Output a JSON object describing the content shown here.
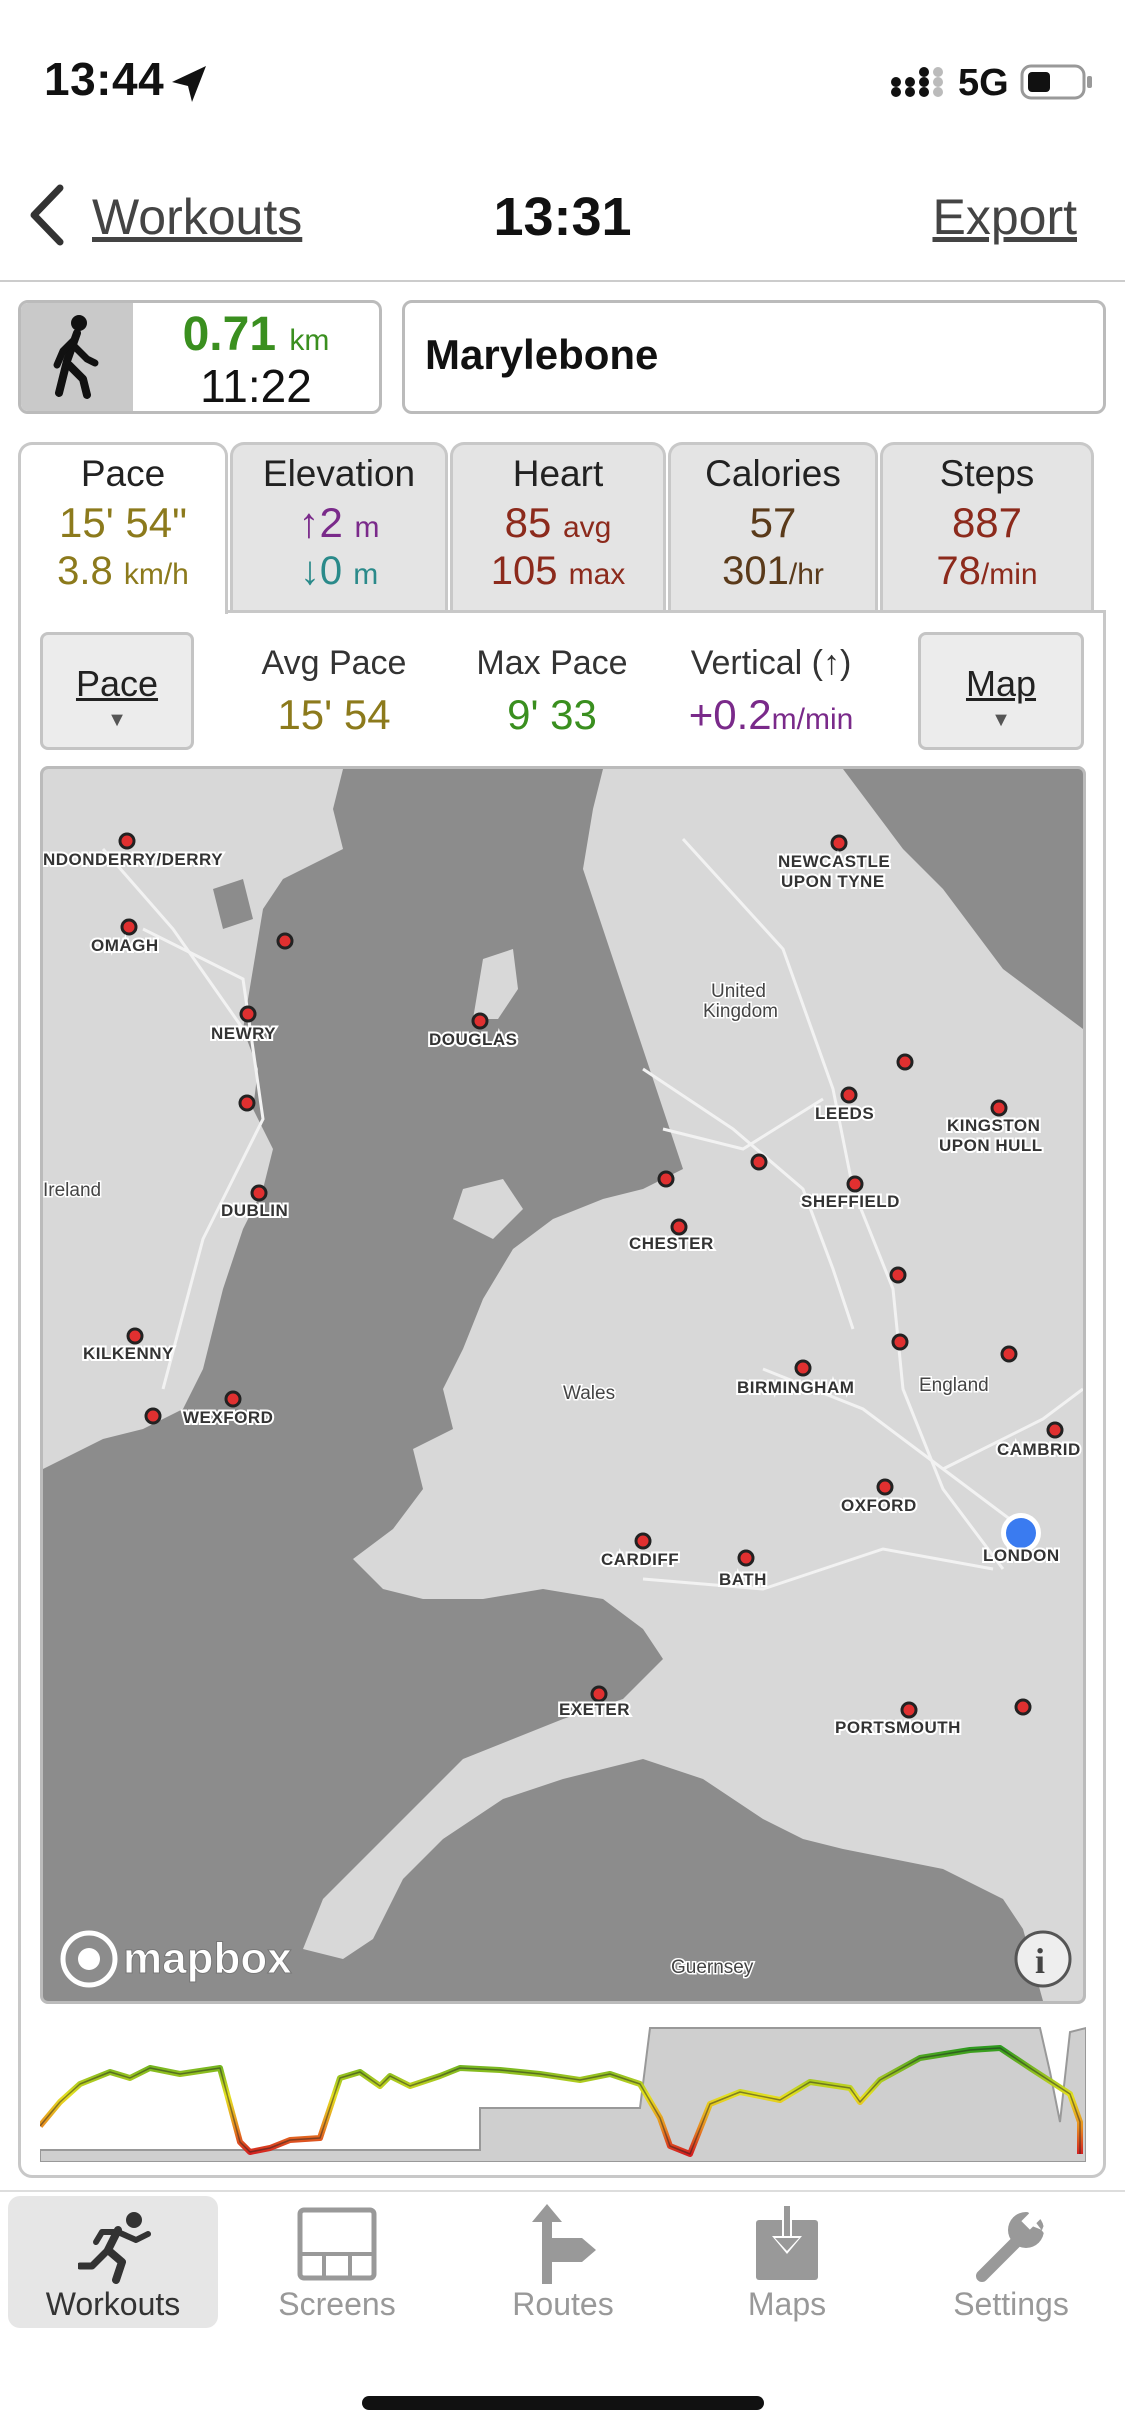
{
  "status_bar": {
    "time": "13:44",
    "network": "5G"
  },
  "nav": {
    "back_label": "Workouts",
    "title": "13:31",
    "export_label": "Export"
  },
  "summary": {
    "distance_value": "0.71",
    "distance_unit": "km",
    "duration": "11:22",
    "location": "Marylebone",
    "activity_icon": "walking-icon"
  },
  "tabs": [
    {
      "title": "Pace",
      "line1": "15' 54\"",
      "line1_unit": "",
      "line2": "3.8",
      "line2_unit": "km/h"
    },
    {
      "title": "Elevation",
      "line1": "↑2",
      "line1_unit": "m",
      "line2": "↓0",
      "line2_unit": "m"
    },
    {
      "title": "Heart",
      "line1": "85",
      "line1_unit": "avg",
      "line2": "105",
      "line2_unit": "max"
    },
    {
      "title": "Calories",
      "line1": "57",
      "line1_unit": "",
      "line2": "301",
      "line2_unit": "/hr"
    },
    {
      "title": "Steps",
      "line1": "887",
      "line1_unit": "",
      "line2": "78",
      "line2_unit": "/min"
    }
  ],
  "controls": {
    "left_button": "Pace",
    "right_button": "Map",
    "stats": [
      {
        "label": "Avg Pace",
        "value": "15' 54",
        "unit": ""
      },
      {
        "label": "Max Pace",
        "value": "9' 33",
        "unit": ""
      },
      {
        "label": "Vertical (↑)",
        "value": "+0.2",
        "unit": "m/min"
      }
    ]
  },
  "map": {
    "attribution": "mapbox",
    "labels": {
      "londonderry": "NDONDERRY/DERRY",
      "omagh": "OMAGH",
      "newry": "NEWRY",
      "ireland": "Ireland",
      "dublin": "DUBLIN",
      "kilkenny": "KILKENNY",
      "wexford": "WEXFORD",
      "douglas": "DOUGLAS",
      "newcastle1": "NEWCASTLE",
      "newcastle2": "UPON TYNE",
      "uk1": "United",
      "uk2": "Kingdom",
      "leeds": "LEEDS",
      "hull1": "KINGSTON",
      "hull2": "UPON HULL",
      "sheffield": "SHEFFIELD",
      "chester": "CHESTER",
      "birmingham": "BIRMINGHAM",
      "england": "England",
      "wales": "Wales",
      "cambridge": "CAMBRID",
      "oxford": "OXFORD",
      "london": "LONDON",
      "cardiff": "CARDIFF",
      "bath": "BATH",
      "exeter": "EXETER",
      "portsmouth": "PORTSMOUTH",
      "guernsey": "Guernsey"
    }
  },
  "tabbar": [
    {
      "label": "Workouts",
      "icon": "running-icon",
      "active": true
    },
    {
      "label": "Screens",
      "icon": "screens-grid-icon",
      "active": false
    },
    {
      "label": "Routes",
      "icon": "route-sign-icon",
      "active": false
    },
    {
      "label": "Maps",
      "icon": "map-download-icon",
      "active": false
    },
    {
      "label": "Settings",
      "icon": "wrench-icon",
      "active": false
    }
  ],
  "colors": {
    "distance_green": "#3a8f1f",
    "pace_gold": "#8c7a1c",
    "elevation_purple": "#7a2a8a",
    "elevation_teal": "#2a8a8a",
    "heart_red": "#8c2a1c",
    "calories_brown": "#5a3a1a",
    "map_sea": "#8c8c8c",
    "map_land": "#d8d8d8",
    "location_blue": "#3a7bf0"
  }
}
